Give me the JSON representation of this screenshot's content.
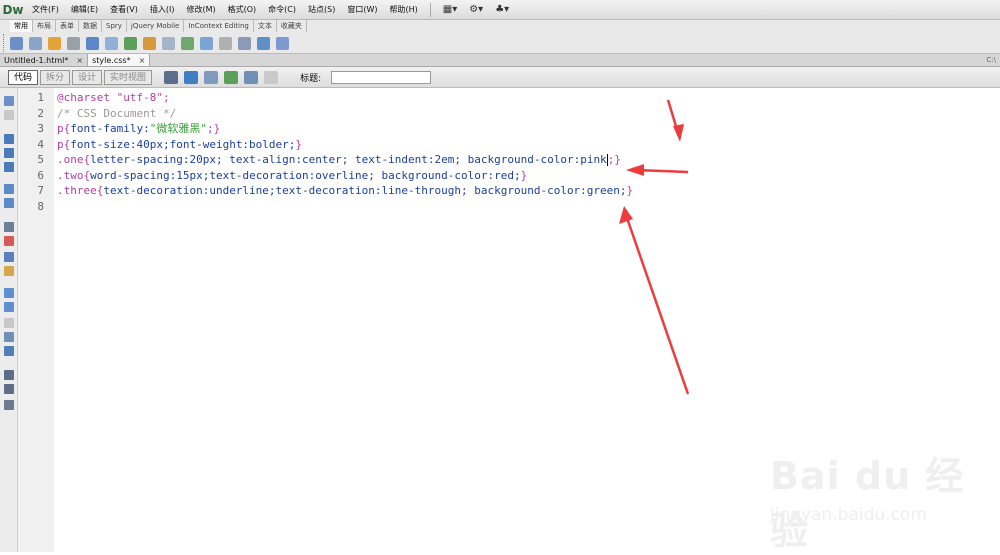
{
  "app": {
    "logo": "Dw"
  },
  "menu": [
    "文件(F)",
    "编辑(E)",
    "查看(V)",
    "插入(I)",
    "修改(M)",
    "格式(O)",
    "命令(C)",
    "站点(S)",
    "窗口(W)",
    "帮助(H)"
  ],
  "insert_tabs": [
    "常用",
    "布局",
    "表单",
    "数据",
    "Spry",
    "jQuery Mobile",
    "InContext Editing",
    "文本",
    "收藏夹"
  ],
  "documents": [
    {
      "name": "Untitled-1.html*",
      "close": "×"
    },
    {
      "name": "style.css*",
      "close": "×"
    }
  ],
  "path": "C:\\",
  "views": [
    "代码",
    "拆分",
    "设计",
    "实时视图"
  ],
  "title_label": "标题:",
  "title_value": "",
  "line_numbers": [
    "1",
    "2",
    "3",
    "4",
    "5",
    "6",
    "7",
    "8"
  ],
  "code_lines": [
    [
      {
        "t": "@charset ",
        "c": "kw"
      },
      {
        "t": "\"utf-8\"",
        "c": "kw"
      },
      {
        "t": ";",
        "c": "kw"
      }
    ],
    [
      {
        "t": "/* CSS Document */",
        "c": "cmt"
      }
    ],
    [
      {
        "t": "p{",
        "c": "sel"
      },
      {
        "t": "font-family:",
        "c": "prop"
      },
      {
        "t": "\"微软雅黑\"",
        "c": "str"
      },
      {
        "t": ";}",
        "c": "sel"
      }
    ],
    [
      {
        "t": "p{",
        "c": "sel"
      },
      {
        "t": "font-size:40px;font-weight:bolder;",
        "c": "prop"
      },
      {
        "t": "}",
        "c": "sel"
      }
    ],
    [
      {
        "t": ".one{",
        "c": "sel"
      },
      {
        "t": "letter-spacing:20px; text-align:center; text-indent:2em; background-color:pink",
        "c": "prop"
      },
      {
        "t": "|",
        "c": "caret"
      },
      {
        "t": ";}",
        "c": "sel"
      }
    ],
    [
      {
        "t": ".two{",
        "c": "sel"
      },
      {
        "t": "word-spacing:15px;text-decoration:overline; background-color:red;",
        "c": "prop"
      },
      {
        "t": "}",
        "c": "sel"
      }
    ],
    [
      {
        "t": ".three{",
        "c": "sel"
      },
      {
        "t": "text-decoration:underline;text-decoration:line-through; background-color:green;",
        "c": "prop"
      },
      {
        "t": "}",
        "c": "sel"
      }
    ],
    []
  ],
  "watermark": {
    "brand": "Bai du 经验",
    "url": "jingyan.baidu.com"
  },
  "colors": {
    "arrow": "#ee3b3b",
    "keyword": "#b53ea0",
    "property": "#1c3f9f",
    "string": "#3a9c3a",
    "comment": "#999999"
  }
}
